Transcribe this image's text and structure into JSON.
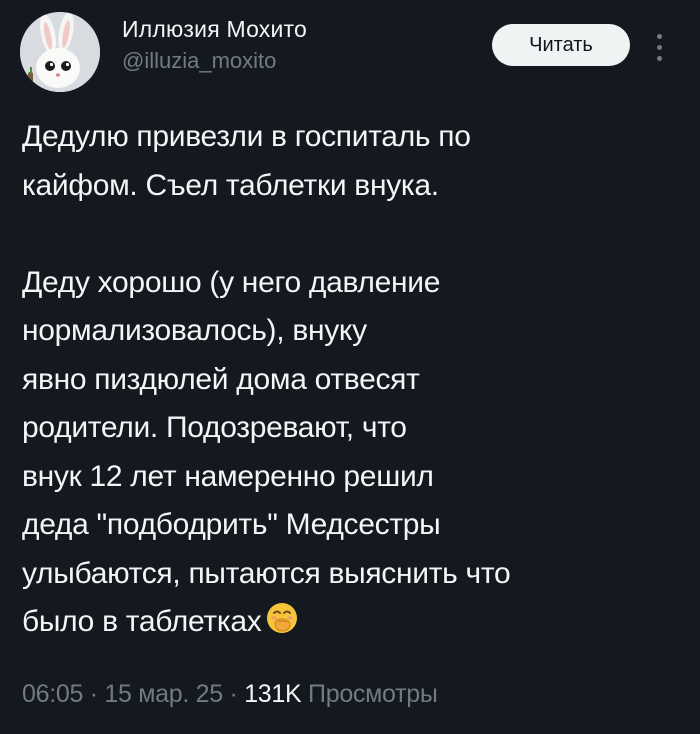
{
  "author": {
    "display_name": "Иллюзия Мохито",
    "handle": "@illuzia_moxito"
  },
  "actions": {
    "follow_label": "Читать"
  },
  "tweet": {
    "paragraph_1": [
      "Дедулю привезли в госпиталь по",
      "кайфом. Съел таблетки внука."
    ],
    "paragraph_2": [
      "Деду хорошо (у него давление",
      "нормализовалось), внуку",
      "явно пиздюлей дома отвесят",
      "родители. Подозревают, что",
      "внук 12 лет намеренно решил",
      "деда \"подбодрить\"  Медсестры",
      "улыбаются, пытаются выяснить что",
      "было в таблетках"
    ],
    "trailing_emoji": "face-with-hand-over-mouth-emoji"
  },
  "meta": {
    "time": "06:05",
    "separator": "·",
    "date": "15 мар. 25",
    "views_count": "131K",
    "views_label": "Просмотры"
  },
  "colors": {
    "background": "#14181f",
    "text_primary": "#f3f5f7",
    "text_secondary": "#737a84",
    "follow_button_bg": "#eff3f4"
  }
}
